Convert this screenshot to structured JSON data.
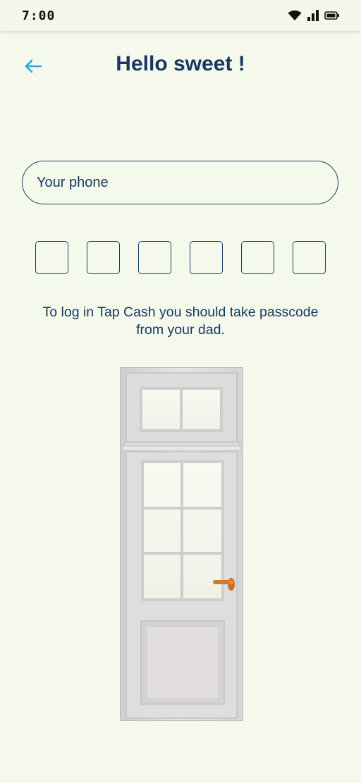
{
  "status_bar": {
    "time": "7:00",
    "icons": [
      "wifi-icon",
      "signal-icon",
      "battery-icon"
    ]
  },
  "header": {
    "back_icon": "arrow-left-icon",
    "title": "Hello sweet !"
  },
  "phone_input": {
    "placeholder": "Your phone",
    "value": ""
  },
  "passcode": {
    "digits": [
      "",
      "",
      "",
      "",
      "",
      ""
    ]
  },
  "info_text": "To log in Tap Cash you should take passcode from your dad.",
  "illustration": "door-illustration",
  "colors": {
    "background": "#f5f9ec",
    "primary_text": "#17375e",
    "accent": "#2aa8e0",
    "door_handle": "#d2792a"
  }
}
